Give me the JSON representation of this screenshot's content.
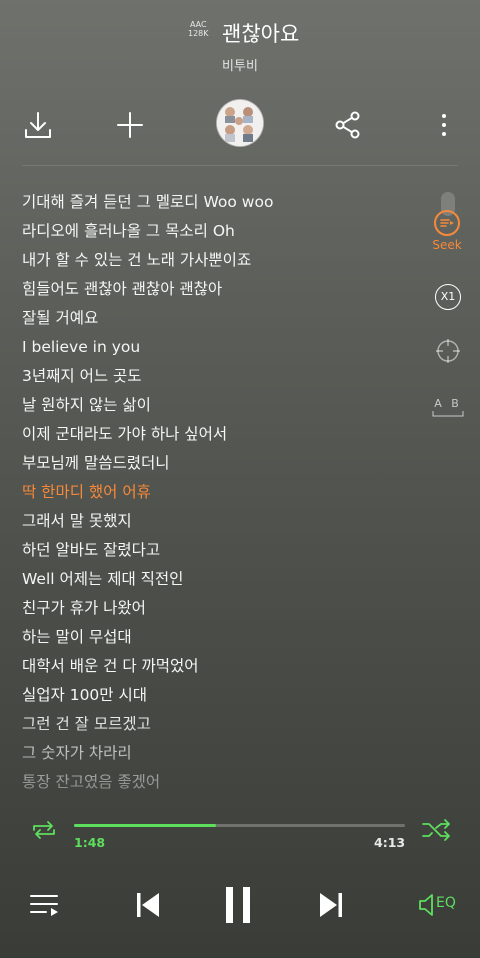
{
  "header": {
    "codec": "AAC",
    "bitrate": "128K",
    "song_title": "괜찮아요",
    "artist": "비투비"
  },
  "toolbar": {
    "download_icon": "download-icon",
    "add_icon": "plus-icon",
    "share_icon": "share-icon",
    "more_icon": "more-vertical-icon"
  },
  "lyrics": {
    "lines": [
      "기대해 즐겨 듣던 그 멜로디 Woo woo",
      "라디오에 흘러나올 그 목소리 Oh",
      "내가 할 수 있는 건 노래 가사뿐이죠",
      "힘들어도 괜찮아 괜찮아 괜찮아",
      "잘될 거예요",
      "I believe in you",
      "3년째지 어느 곳도",
      "날 원하지 않는 삶이",
      "이제 군대라도 가야 하나 싶어서",
      "부모님께 말씀드렸더니",
      "딱 한마디 했어 어휴",
      "그래서 말 못했지",
      "하던 알바도 잘렸다고",
      "Well 어제는 제대 직전인",
      "친구가 휴가 나왔어",
      "하는 말이 무섭대",
      "대학서 배운 건 다 까먹었어",
      "실업자 100만 시대",
      "그런 건 잘 모르겠고",
      "그 숫자가 차라리",
      "통장 잔고였음 좋겠어"
    ],
    "active_index": 10
  },
  "side_controls": {
    "seek_label": "Seek",
    "speed_label": "X1",
    "ab_label": "A B"
  },
  "progress": {
    "elapsed": "1:48",
    "total": "4:13",
    "fraction": 0.43
  },
  "player": {
    "eq_label": "EQ"
  },
  "colors": {
    "accent_orange": "#f6893a",
    "accent_green": "#5dde5d"
  }
}
